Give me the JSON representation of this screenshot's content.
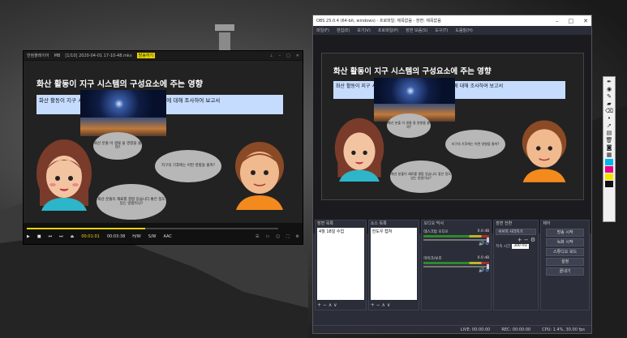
{
  "player": {
    "app_name": "한컴플레이어",
    "menu_hint": "MB",
    "file_title": "[1/10] 2020-04-01 17-10-48.mkv",
    "badge": "방송하기",
    "current_time": "00:01:01",
    "total_time": "00:03:38",
    "progress": 0.47,
    "mode_a": "H/W",
    "mode_b": "S/W",
    "mode_c": "AAC"
  },
  "slide": {
    "title": "화산 활동이 지구 시스템의 구성요소에 주는 영향",
    "box_text": "화산 활동이 지구 시스템(권, 기권, 생물권 등)에 주는 영향에 대해 조사하여 보고서",
    "bubble1": "화산 분출 이 생물 들 영향을 줄까?",
    "bubble2": "지구의 기후에는 어떤 영향을 줄까?",
    "bubble3": "화산 분출이 재료를 결합 있습니다 좋은 정도 있는 방법이냐?"
  },
  "obs": {
    "window_title": "OBS 25.0.4 (64-bit, windows) - 프로파일: 제목없음 - 장면: 제목없음",
    "menu": [
      "파일(F)",
      "편집(E)",
      "보기(V)",
      "프로파일(P)",
      "장면 모음(S)",
      "도구(T)",
      "도움말(H)"
    ],
    "docks": {
      "scenes_label": "장면 목록",
      "scene_item": "4월 18일 수업",
      "sources_label": "소스 목록",
      "source_item": "한도우 캡쳐",
      "mixer_label": "오디오 믹서",
      "mixer_tracks": [
        {
          "name": "데스크탑 오디오",
          "level": "0.0 dB"
        },
        {
          "name": "마이크/보조",
          "level": "0.0 dB"
        }
      ],
      "transitions_label": "장면 전환",
      "transition_type": "서서히 사라지기",
      "duration_label": "지속 시간",
      "duration_value": "300 ms",
      "controls_label": "제어",
      "controls": [
        "방송 시작",
        "녹화 시작",
        "스튜디오 모드",
        "설정",
        "끝내기"
      ],
      "tools": "+ − ∧ ∨"
    },
    "status": {
      "live": "LIVE: 00:00:00",
      "rec": "REC: 00:00:00",
      "cpu": "CPU: 1.4%, 30.00 fps"
    }
  },
  "colors": {
    "accent_yellow": "#e8d400",
    "slide_bg": "#222222",
    "box_blue": "#c6dcff"
  }
}
